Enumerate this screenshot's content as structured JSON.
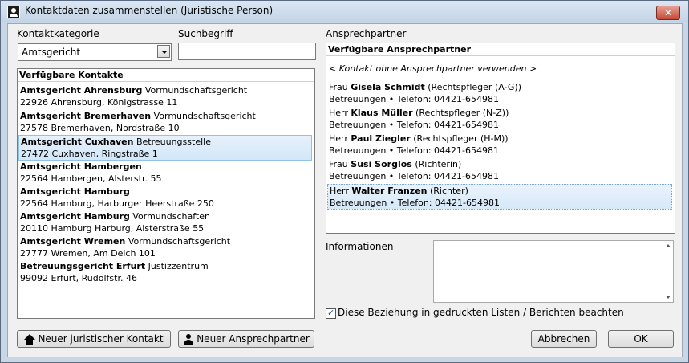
{
  "window": {
    "title": "Kontaktdaten zusammenstellen (Juristische Person)"
  },
  "filters": {
    "category_label": "Kontaktkategorie",
    "category_value": "Amtsgericht",
    "search_label": "Suchbegriff",
    "search_value": ""
  },
  "contacts": {
    "header": "Verfügbare Kontakte",
    "items": [
      {
        "name": "Amtsgericht Ahrensburg",
        "detail": "Vormundschaftsgericht",
        "address": "22926 Ahrensburg, Königstrasse 11"
      },
      {
        "name": "Amtsgericht Bremerhaven",
        "detail": "Vormundschaftsgericht",
        "address": "27578 Bremerhaven, Nordstraße 10"
      },
      {
        "name": "Amtsgericht Cuxhaven",
        "detail": "Betreuungsstelle",
        "address": "27472 Cuxhaven, Ringstraße 1"
      },
      {
        "name": "Amtsgericht Hambergen",
        "detail": "",
        "address": "22564 Hambergen, Alsterstr. 55"
      },
      {
        "name": "Amtsgericht Hamburg",
        "detail": "",
        "address": "22564 Hamburg, Harburger Heerstraße 250"
      },
      {
        "name": "Amtsgericht Hamburg",
        "detail": "Vormundschaften",
        "address": "20110 Hamburg Harburg, Alsterstraße 55"
      },
      {
        "name": "Amtsgericht Wremen",
        "detail": "Vormundschaftsgericht",
        "address": "27777 Wremen, Am Deich 101"
      },
      {
        "name": "Betreuungsgericht Erfurt",
        "detail": "Justizzentrum",
        "address": "99092 Erfurt, Rudolfstr. 46"
      }
    ]
  },
  "persons": {
    "section_label": "Ansprechpartner",
    "header": "Verfügbare Ansprechpartner",
    "no_contact": "< Kontakt ohne Ansprechpartner verwenden >",
    "items": [
      {
        "salutation": "Frau",
        "name": "Gisela Schmidt",
        "role": "(Rechtspfleger (A-G))",
        "info": "Betreuungen • Telefon: 04421-654981"
      },
      {
        "salutation": "Herr",
        "name": "Klaus Müller",
        "role": "(Rechtspfleger (N-Z))",
        "info": "Betreuungen • Telefon: 04421-654981"
      },
      {
        "salutation": "Herr",
        "name": "Paul Ziegler",
        "role": "(Rechtspfleger (H-M))",
        "info": "Betreuungen • Telefon: 04421-654981"
      },
      {
        "salutation": "Frau",
        "name": "Susi Sorglos",
        "role": "(Richterin)",
        "info": "Betreuungen • Telefon: 04421-654981"
      },
      {
        "salutation": "Herr",
        "name": "Walter Franzen",
        "role": "(Richter)",
        "info": "Betreuungen • Telefon: 04421-654981"
      }
    ]
  },
  "information": {
    "label": "Informationen",
    "value": ""
  },
  "print_checkbox": {
    "label": "Diese Beziehung in gedruckten Listen / Berichten beachten"
  },
  "buttons": {
    "new_legal": "Neuer juristischer Kontakt",
    "new_person": "Neuer Ansprechpartner",
    "cancel": "Abbrechen",
    "ok": "OK"
  }
}
